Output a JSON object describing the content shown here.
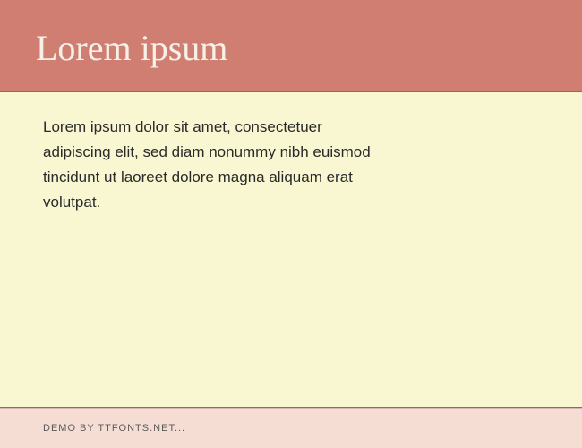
{
  "header": {
    "title": "Lorem ipsum"
  },
  "content": {
    "body_text": "Lorem ipsum dolor sit amet, consectetuer adipiscing elit, sed diam nonummy nibh euismod tincidunt ut laoreet dolore magna aliquam erat volutpat."
  },
  "footer": {
    "text": "DEMO BY TTFONTS.NET..."
  },
  "colors": {
    "header_bg": "#d07e72",
    "content_bg": "#f9f7d1",
    "footer_bg": "#f5ddd4",
    "header_text": "#f5f0e8",
    "body_text": "#2a2a2a",
    "footer_text": "#5a5a5a",
    "divider": "#6b7a6e"
  }
}
